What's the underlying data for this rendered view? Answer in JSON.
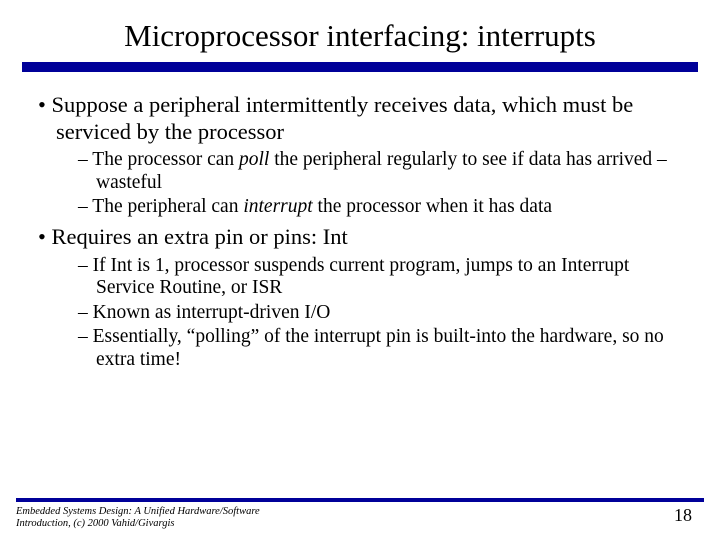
{
  "title": "Microprocessor interfacing: interrupts",
  "bullets": {
    "b1": "Suppose a peripheral intermittently receives data, which must be serviced by the processor",
    "b1s1a": "The processor can ",
    "b1s1b": "poll",
    "b1s1c": " the peripheral regularly to see if data has arrived – wasteful",
    "b1s2a": "The peripheral can ",
    "b1s2b": "interrupt",
    "b1s2c": " the processor when it has data",
    "b2": "Requires an extra pin or pins: Int",
    "b2s1": "If Int is 1, processor suspends current program, jumps to an Interrupt Service Routine, or ISR",
    "b2s2": "Known as interrupt-driven I/O",
    "b2s3": "Essentially, “polling” of the interrupt pin is built-into the hardware, so no extra time!"
  },
  "footer": {
    "source": "Embedded Systems Design: A Unified Hardware/Software Introduction, (c) 2000 Vahid/Givargis",
    "page": "18"
  }
}
